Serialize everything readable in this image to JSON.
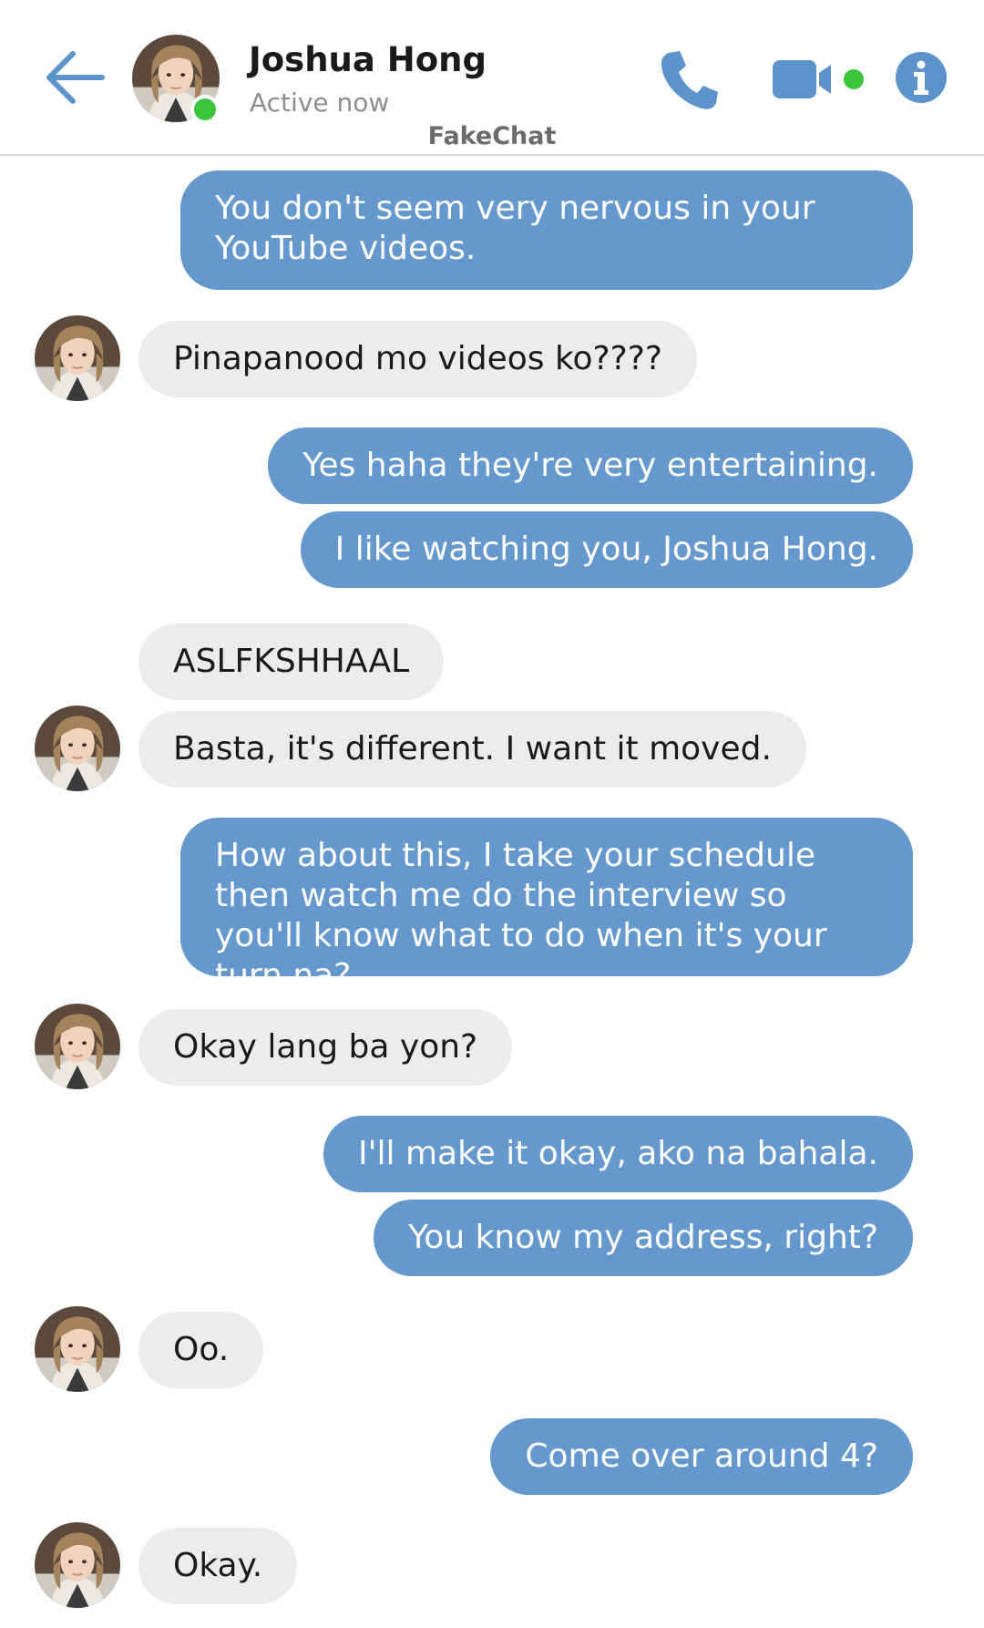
{
  "header": {
    "contact_name": "Joshua Hong",
    "status": "Active now",
    "app_name": "FakeChat",
    "icons": [
      "back-arrow-icon",
      "phone-icon",
      "video-camera-icon",
      "info-icon"
    ],
    "accent_color": "#6598cc",
    "online_color": "#3cc43c"
  },
  "messages": [
    {
      "from": "me",
      "text": "You don't seem very nervous in your YouTube videos."
    },
    {
      "from": "contact",
      "text": "Pinapanood mo videos ko????"
    },
    {
      "from": "me",
      "text": "Yes haha they're very entertaining."
    },
    {
      "from": "me",
      "text": "I like watching you, Joshua Hong."
    },
    {
      "from": "contact",
      "text": "ASLFKSHHAAL"
    },
    {
      "from": "contact",
      "text": "Basta, it's different. I want it moved."
    },
    {
      "from": "me",
      "text": "How about this, I take your schedule then watch me do the interview so you'll know what to do when it's your turn na?"
    },
    {
      "from": "contact",
      "text": "Okay lang ba yon?"
    },
    {
      "from": "me",
      "text": "I'll make it okay, ako na bahala."
    },
    {
      "from": "me",
      "text": "You know my address, right?"
    },
    {
      "from": "contact",
      "text": "Oo."
    },
    {
      "from": "me",
      "text": "Come over around 4?"
    },
    {
      "from": "contact",
      "text": "Okay."
    }
  ]
}
